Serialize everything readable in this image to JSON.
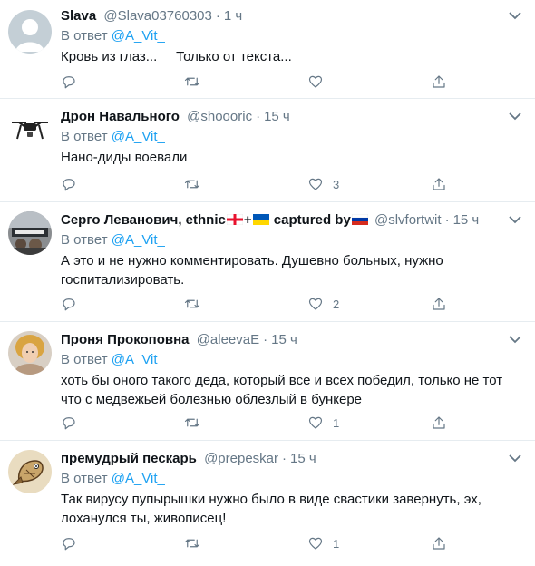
{
  "reply_prefix": "В ответ",
  "colors": {
    "accent": "#1da1f2",
    "muted": "#657786",
    "divider": "#e6ecf0"
  },
  "tweets": [
    {
      "name": "Slava",
      "handle": "@Slava03760303",
      "time": "1 ч",
      "reply_to": "@A_Vit_",
      "text": "Кровь из глаз...     Только от текста...",
      "replies": "",
      "retweets": "",
      "likes": "",
      "avatar": "default-avatar-icon"
    },
    {
      "name": "Дрон Навального",
      "handle": "@shoooric",
      "time": "15 ч",
      "reply_to": "@A_Vit_",
      "text": "Нано-диды воевали",
      "replies": "",
      "retweets": "",
      "likes": "3",
      "avatar": "drone-avatar-icon"
    },
    {
      "name_part1": "Серго Леванович, ethnic",
      "name_part2": "+",
      "name_part3": "captured by",
      "handle": "@slvfortwit",
      "time": "15 ч",
      "reply_to": "@A_Vit_",
      "text": "А это и не нужно комментировать. Душевно больных, нужно госпитализировать.",
      "replies": "",
      "retweets": "",
      "likes": "2",
      "avatar": "photo-avatar"
    },
    {
      "name": "Проня Прокоповна",
      "handle": "@aleevaE",
      "time": "15 ч",
      "reply_to": "@A_Vit_",
      "text": "хоть бы оного такого деда, который все и всех победил, только не тот что с медвежьей болезнью облезлый в бункере",
      "replies": "",
      "retweets": "",
      "likes": "1",
      "avatar": "photo-avatar"
    },
    {
      "name": "премудрый пескарь",
      "handle": "@prepeskar",
      "time": "15 ч",
      "reply_to": "@A_Vit_",
      "text": "Так вирусу пупырышки нужно было в виде свастики завернуть, эх, лоханулся ты, живописец!",
      "replies": "",
      "retweets": "",
      "likes": "1",
      "avatar": "fish-avatar-icon"
    }
  ]
}
